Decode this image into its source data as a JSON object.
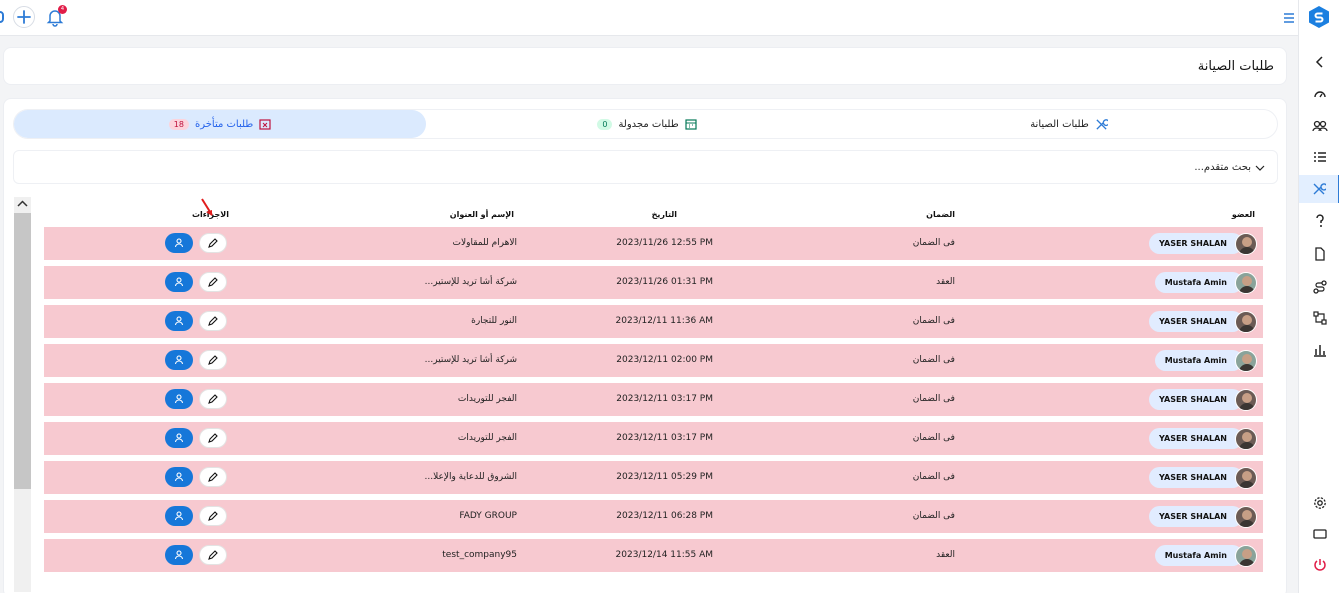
{
  "topbar": {
    "notification_count": "4"
  },
  "page": {
    "title": "طلبات الصيانة"
  },
  "tabs": [
    {
      "label": "طلبات الصيانة",
      "count": ""
    },
    {
      "label": "طلبات مجدولة",
      "count": "0"
    },
    {
      "label": "طلبات متأخرة",
      "count": "18"
    }
  ],
  "search": {
    "label": "بحث متقدم..."
  },
  "table": {
    "headers": {
      "member": "العضو",
      "warranty": "الضمان",
      "date": "التاريخ",
      "name": "الإسم أو العنوان",
      "actions": "الاجراءات"
    },
    "rows": [
      {
        "member": "YASER SHALAN",
        "warranty": "فى الضمان",
        "date": "2023/11/26 12:55 PM",
        "name": "الاهرام للمقاولات"
      },
      {
        "member": "Mustafa Amin",
        "warranty": "العقد",
        "date": "2023/11/26 01:31 PM",
        "name": "شركة أشا تريد للإستير..."
      },
      {
        "member": "YASER SHALAN",
        "warranty": "فى الضمان",
        "date": "2023/12/11 11:36 AM",
        "name": "النور للتجارة"
      },
      {
        "member": "Mustafa Amin",
        "warranty": "فى الضمان",
        "date": "2023/12/11 02:00 PM",
        "name": "شركة أشا تريد للإستير..."
      },
      {
        "member": "YASER SHALAN",
        "warranty": "فى الضمان",
        "date": "2023/12/11 03:17 PM",
        "name": "الفجر للتوريدات"
      },
      {
        "member": "YASER SHALAN",
        "warranty": "فى الضمان",
        "date": "2023/12/11 03:17 PM",
        "name": "الفجر للتوريدات"
      },
      {
        "member": "YASER SHALAN",
        "warranty": "فى الضمان",
        "date": "2023/12/11 05:29 PM",
        "name": "الشروق للدعاية والإعلا..."
      },
      {
        "member": "YASER SHALAN",
        "warranty": "فى الضمان",
        "date": "2023/12/11 06:28 PM",
        "name": "FADY GROUP"
      },
      {
        "member": "Mustafa Amin",
        "warranty": "العقد",
        "date": "2023/12/14 11:55 AM",
        "name": "test_company95"
      }
    ]
  },
  "colors": {
    "accent": "#1677d9",
    "row_overdue": "#f7c9d0",
    "tab_active": "#dbeafe"
  }
}
